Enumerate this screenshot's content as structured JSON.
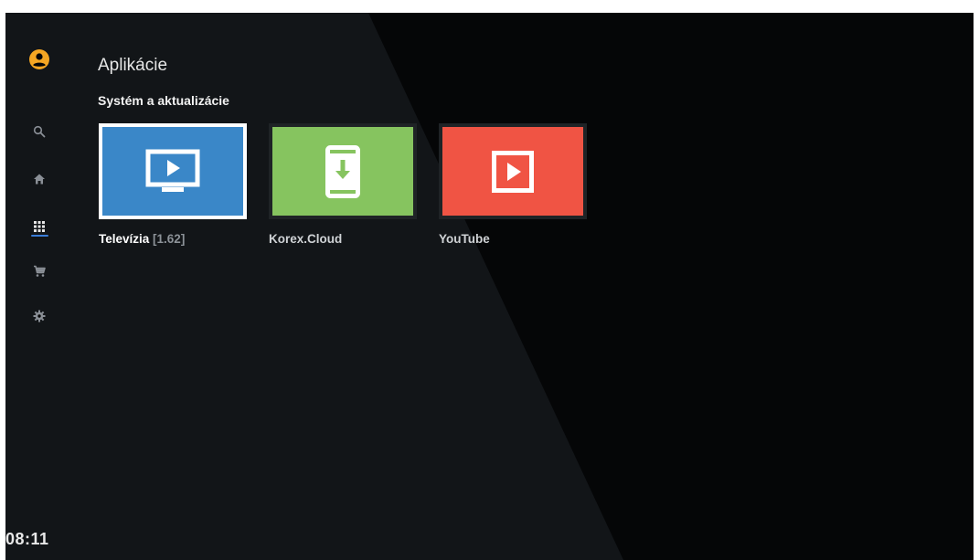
{
  "app": {
    "page_title": "Aplikácie",
    "section_title": "Systém a aktualizácie",
    "clock": "08:11"
  },
  "sidebar": {
    "items": [
      {
        "name": "account",
        "icon": "account-circle-icon",
        "color": "#f5a623"
      },
      {
        "name": "search",
        "icon": "search-icon"
      },
      {
        "name": "home",
        "icon": "home-icon"
      },
      {
        "name": "apps",
        "icon": "apps-grid-icon",
        "active": true
      },
      {
        "name": "store",
        "icon": "cart-icon"
      },
      {
        "name": "settings",
        "icon": "gear-icon"
      }
    ],
    "active_color": "#3b7dd8"
  },
  "apps": [
    {
      "label": "Televízia",
      "version": "[1.62]",
      "color": "#3a87c8",
      "icon": "tv-play-icon",
      "focused": true
    },
    {
      "label": "Korex.Cloud",
      "version": "",
      "color": "#86c45f",
      "icon": "phone-download-icon",
      "focused": false
    },
    {
      "label": "YouTube",
      "version": "",
      "color": "#f05444",
      "icon": "play-box-icon",
      "focused": false
    }
  ]
}
